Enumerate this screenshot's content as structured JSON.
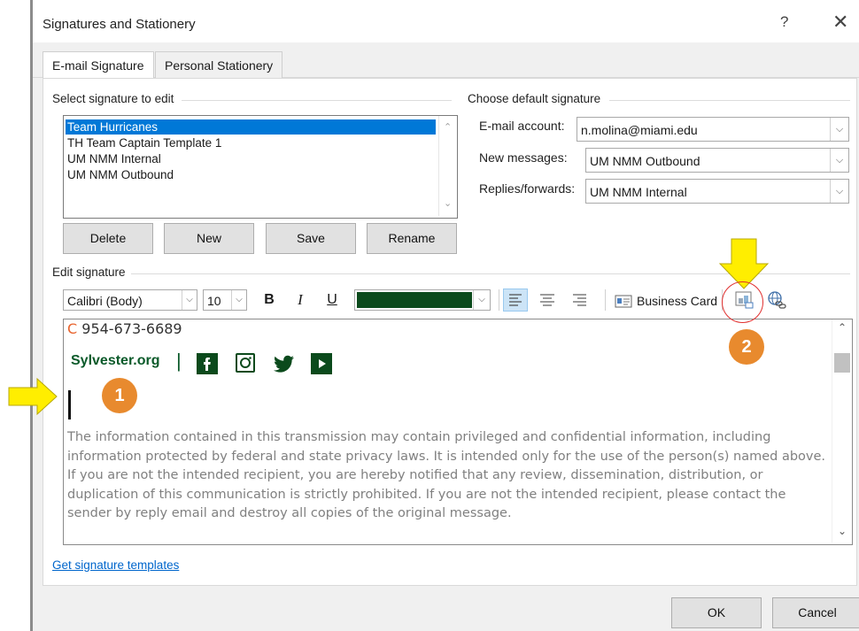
{
  "window": {
    "title": "Signatures and Stationery",
    "help_icon": "?",
    "close_icon": "✕"
  },
  "tabs": [
    {
      "label": "E-mail Signature",
      "active": true
    },
    {
      "label": "Personal Stationery",
      "active": false
    }
  ],
  "select_signature": {
    "label": "Select signature to edit",
    "items": [
      "Team Hurricanes",
      "TH Team Captain Template 1",
      "UM NMM Internal",
      "UM NMM Outbound"
    ],
    "selected": "Team Hurricanes"
  },
  "buttons": {
    "delete": "Delete",
    "new": "New",
    "save": "Save",
    "rename": "Rename",
    "ok": "OK",
    "cancel": "Cancel"
  },
  "default_signature": {
    "label": "Choose default signature",
    "email_account_label": "E-mail account:",
    "email_account_value": "n.molina@miami.edu",
    "new_messages_label": "New messages:",
    "new_messages_value": "UM NMM Outbound",
    "replies_label": "Replies/forwards:",
    "replies_value": "UM NMM Internal"
  },
  "edit_signature": {
    "label": "Edit signature",
    "font": "Calibri (Body)",
    "size": "10",
    "bold": "B",
    "italic": "I",
    "underline": "U",
    "color": "#0b4a1c",
    "business_card": "Business Card"
  },
  "signature_content": {
    "phone_prefix": "C",
    "phone": "954-673-6689",
    "site": "Sylvester.org",
    "site_color": "#0b5a2a",
    "divider": "|",
    "social_icons": [
      "facebook-icon",
      "instagram-icon",
      "twitter-icon",
      "youtube-icon"
    ],
    "disclaimer": "The information contained in this transmission may contain privileged and confidential information, including information protected by federal and state privacy laws. It is intended only for the use of the person(s) named above. If you are not the intended recipient, you are hereby notified that any review, dissemination, distribution, or duplication of this communication is strictly prohibited. If you are not the intended recipient, please contact the sender by reply email and destroy all copies of the original message."
  },
  "footer": {
    "templates_link": "Get signature templates"
  },
  "annotations": {
    "badge1": "1",
    "badge2": "2",
    "arrow_color": "#ffee00",
    "badge_color": "#e88a2e"
  }
}
